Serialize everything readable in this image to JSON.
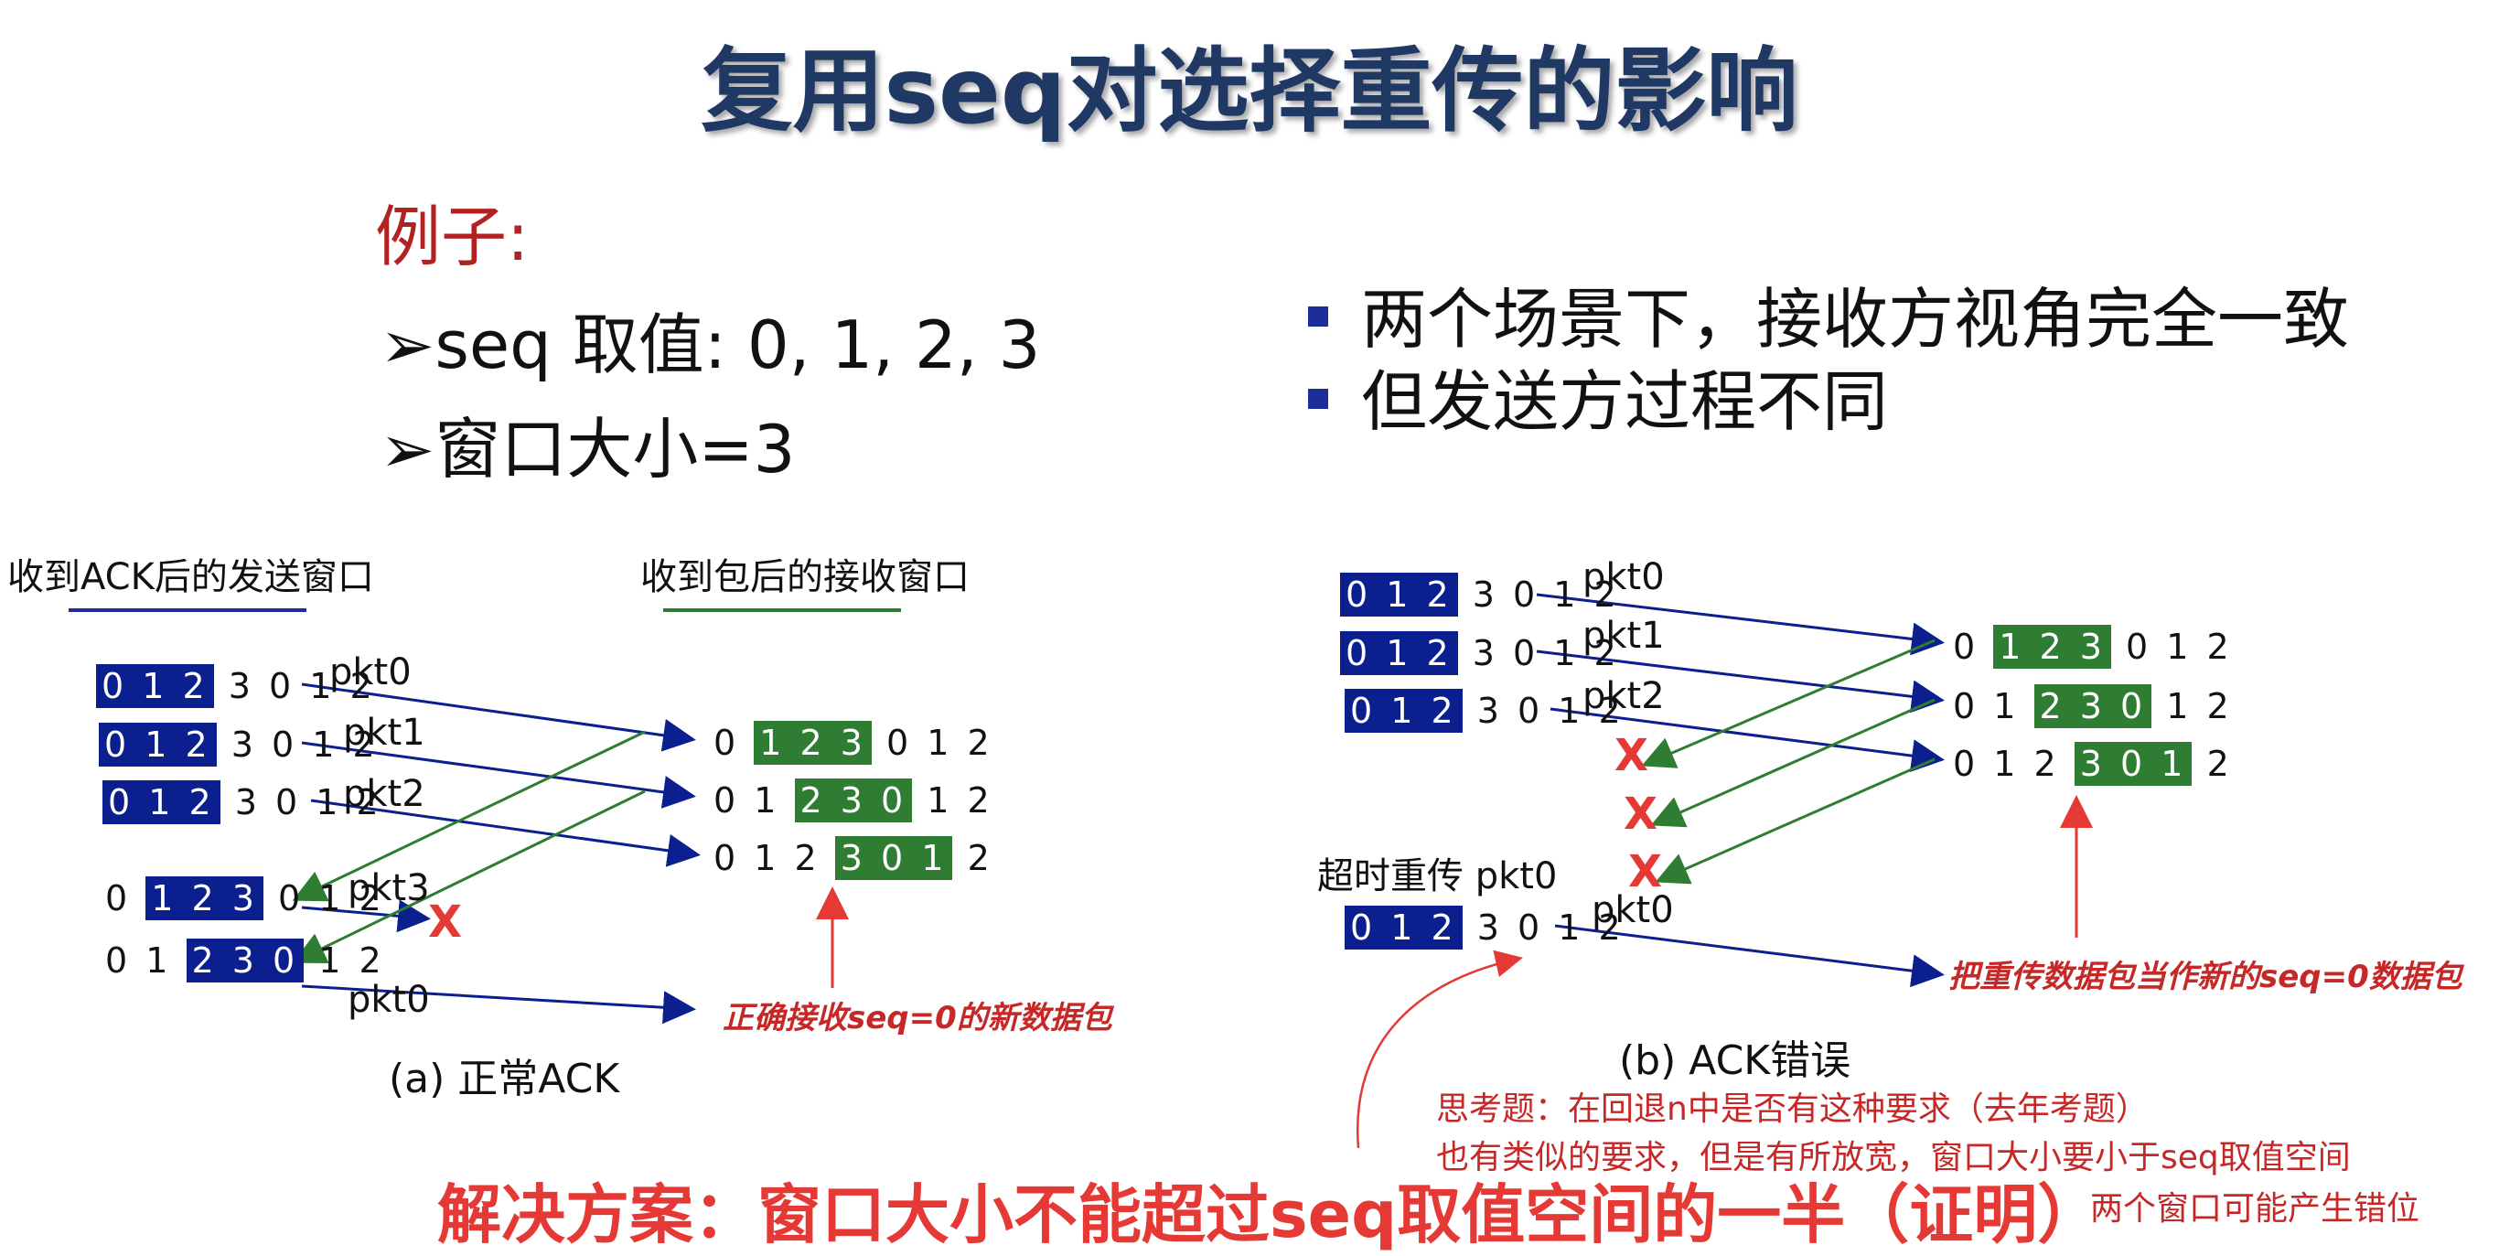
{
  "title": "复用seq对选择重传的影响",
  "example": {
    "heading": "例子:",
    "items": [
      "➢seq 取值: 0, 1, 2, 3",
      "➢窗口大小=3"
    ]
  },
  "right_bullets": [
    "两个场景下，接收方视角完全一致",
    "但发送方过程不同"
  ],
  "panel_a": {
    "send_label": "收到ACK后的发送窗口",
    "recv_label": "收到包后的接收窗口",
    "send_rows": [
      {
        "pre": "",
        "win": "0 1 2",
        "post": " 3 0 1 2"
      },
      {
        "pre": "",
        "win": "0 1 2",
        "post": " 3 0 1 2"
      },
      {
        "pre": "",
        "win": "0 1 2",
        "post": " 3 0 1 2"
      },
      {
        "pre": "0 ",
        "win": "1 2 3",
        "post": " 0 1 2"
      },
      {
        "pre": "0 1 ",
        "win": "2 3 0",
        "post": " 1 2"
      }
    ],
    "recv_rows": [
      {
        "pre": "0 ",
        "win": "1 2 3",
        "post": " 0 1 2"
      },
      {
        "pre": "0 1 ",
        "win": "2 3 0",
        "post": " 1 2"
      },
      {
        "pre": "0 1 2 ",
        "win": "3 0 1",
        "post": " 2"
      }
    ],
    "pkts": [
      "pkt0",
      "pkt1",
      "pkt2",
      "pkt3",
      "pkt0"
    ],
    "x": "X",
    "note": "正确接收seq=0的新数据包",
    "caption": "(a) 正常ACK"
  },
  "panel_b": {
    "send_rows": [
      {
        "pre": "",
        "win": "0 1 2",
        "post": " 3 0 1 2"
      },
      {
        "pre": "",
        "win": "0 1 2",
        "post": " 3 0 1 2"
      },
      {
        "pre": "",
        "win": "0 1 2",
        "post": " 3 0 1 2"
      },
      {
        "pre": "",
        "win": "0 1 2",
        "post": " 3 0 1 2"
      }
    ],
    "recv_rows": [
      {
        "pre": "0 ",
        "win": "1 2 3",
        "post": " 0 1 2"
      },
      {
        "pre": "0 1 ",
        "win": "2 3 0",
        "post": " 1 2"
      },
      {
        "pre": "0 1 2 ",
        "win": "3 0 1",
        "post": " 2"
      }
    ],
    "pkts": [
      "pkt0",
      "pkt1",
      "pkt2",
      "pkt0"
    ],
    "x": "X",
    "retransmit_label": "超时重传 pkt0",
    "note": "把重传数据包当作新的seq=0数据包",
    "caption": "(b) ACK错误"
  },
  "think": [
    "思考题：在回退n中是否有这种要求（去年考题）",
    "也有类似的要求，但是有所放宽，窗口大小要小于seq取值空间",
    "两个窗口可能产生错位"
  ],
  "solution": "解决方案：窗口大小不能超过seq取值空间的一半（证明）",
  "colors": {
    "title": "#1f3864",
    "window_blue": "#0b1f8f",
    "window_green": "#2e7d32",
    "accent_red": "#e53935"
  }
}
